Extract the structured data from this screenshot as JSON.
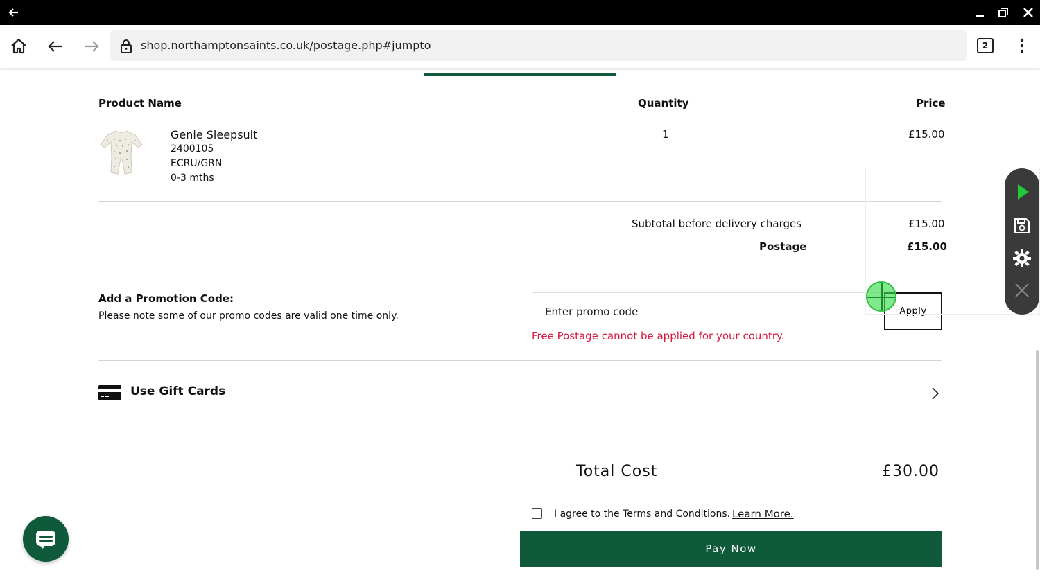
{
  "browser": {
    "url": "shop.northamptonsaints.co.uk/postage.php#jumpto",
    "tab_count": "2"
  },
  "table": {
    "headers": {
      "product": "Product Name",
      "quantity": "Quantity",
      "price": "Price"
    },
    "item": {
      "name": "Genie Sleepsuit",
      "code": "2400105",
      "colour": "ECRU/GRN",
      "size": "0-3 mths",
      "quantity": "1",
      "price": "£15.00"
    }
  },
  "summary": {
    "subtotal_label": "Subtotal before delivery charges",
    "subtotal_value": "£15.00",
    "postage_label": "Postage",
    "postage_value": "£15.00"
  },
  "promo": {
    "title": "Add a Promotion Code:",
    "note": "Please note some of our promo codes are valid one time only.",
    "placeholder": "Enter promo code",
    "apply_label": "Apply",
    "error": "Free Postage cannot be applied for your country."
  },
  "gift_cards": {
    "label": "Use Gift Cards"
  },
  "total": {
    "label": "Total Cost",
    "value": "£30.00"
  },
  "terms": {
    "text": "I agree to the Terms and Conditions.",
    "link": "Learn More."
  },
  "pay": {
    "label": "Pay Now"
  },
  "colors": {
    "brand_green": "#0e5a3a",
    "error_red": "#d41b3c",
    "cursor_green": "#3cdc50"
  }
}
